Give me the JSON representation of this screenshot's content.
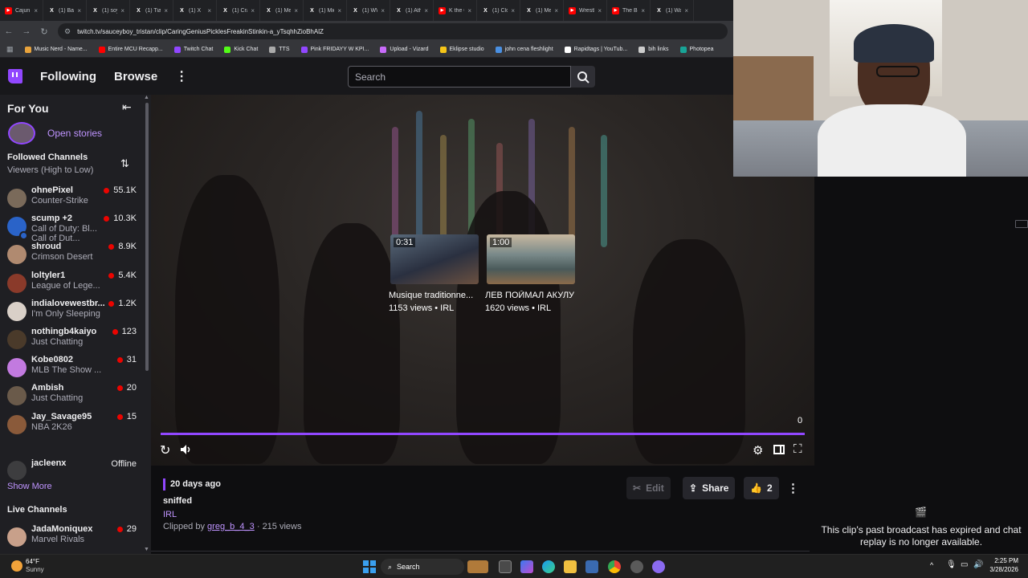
{
  "browser": {
    "tabs": [
      {
        "label": "Cajun C",
        "color": "#ff0000",
        "glyph": "▶"
      },
      {
        "label": "(1) Bad",
        "color": "#ffffff",
        "glyph": "X"
      },
      {
        "label": "(1) soy",
        "color": "#ffffff",
        "glyph": "X"
      },
      {
        "label": "(1) Tian",
        "color": "#ffffff",
        "glyph": "X"
      },
      {
        "label": "(1) X",
        "color": "#ffffff",
        "glyph": "X"
      },
      {
        "label": "(1) Craz",
        "color": "#ffffff",
        "glyph": "X"
      },
      {
        "label": "(1) Med",
        "color": "#ffffff",
        "glyph": "X"
      },
      {
        "label": "(1) Mich",
        "color": "#ffffff",
        "glyph": "X"
      },
      {
        "label": "(1) WW",
        "color": "#ffffff",
        "glyph": "X"
      },
      {
        "label": "(1) Athl",
        "color": "#ffffff",
        "glyph": "X"
      },
      {
        "label": "K the C",
        "color": "#ff0000",
        "glyph": "▶"
      },
      {
        "label": "(1) Clov",
        "color": "#ffffff",
        "glyph": "X"
      },
      {
        "label": "(1) Med",
        "color": "#ffffff",
        "glyph": "X"
      },
      {
        "label": "Wrestlin",
        "color": "#ff0000",
        "glyph": "▶"
      },
      {
        "label": "The BE",
        "color": "#ff0000",
        "glyph": "▶"
      },
      {
        "label": "(1) Wan",
        "color": "#ffffff",
        "glyph": "X"
      }
    ],
    "url": "twitch.tv/sauceyboy_tristan/clip/CaringGeniusPicklesFreakinStinkin-a_yTsqhhZioBhAlZ",
    "bookmarks": [
      {
        "label": "Music Nerd - Name...",
        "color": "#e8a33c"
      },
      {
        "label": "Entire MCU Recapp...",
        "color": "#ff0000"
      },
      {
        "label": "Twitch Chat",
        "color": "#9147ff"
      },
      {
        "label": "Kick Chat",
        "color": "#53fc18"
      },
      {
        "label": "TTS",
        "color": "#aaaaaa"
      },
      {
        "label": "Pink FRIDAYY W KPI...",
        "color": "#9147ff"
      },
      {
        "label": "Upload - Vizard",
        "color": "#c86bfa"
      },
      {
        "label": "Eklipse studio",
        "color": "#f5c518"
      },
      {
        "label": "john cena fleshlight",
        "color": "#4a90e2"
      },
      {
        "label": "Rapidtags | YouTub...",
        "color": "#ffffff"
      },
      {
        "label": "bih links",
        "color": "#cccccc"
      },
      {
        "label": "Photopea",
        "color": "#18a497"
      }
    ]
  },
  "topnav": {
    "following": "Following",
    "browse": "Browse",
    "search_placeholder": "Search"
  },
  "sidebar": {
    "for_you": "For You",
    "open_stories": "Open stories",
    "followed_title": "Followed Channels",
    "sort": "Viewers (High to Low)",
    "channels": [
      {
        "name": "ohnePixel",
        "game": "Counter-Strike",
        "viewers": "55.1K",
        "color": "#7a6a5a"
      },
      {
        "name": "scump +2",
        "game": "Call of Duty: Bl...",
        "game2": "Call of Dut...",
        "viewers": "10.3K",
        "color": "#2a63c8"
      },
      {
        "name": "shroud",
        "game": "Crimson Desert",
        "viewers": "8.9K",
        "color": "#b08a70"
      },
      {
        "name": "loltyler1",
        "game": "League of Lege...",
        "viewers": "5.4K",
        "color": "#8a3a2a"
      },
      {
        "name": "indialovewestbr...",
        "game": "I'm Only Sleeping",
        "viewers": "1.2K",
        "color": "#d9d0c8"
      },
      {
        "name": "nothingb4kaiyo",
        "game": "Just Chatting",
        "viewers": "123",
        "color": "#4a3a2a"
      },
      {
        "name": "Kobe0802",
        "game": "MLB The Show ...",
        "viewers": "31",
        "color": "#c27adf"
      },
      {
        "name": "Ambish",
        "game": "Just Chatting",
        "viewers": "20",
        "color": "#6a5a4a"
      },
      {
        "name": "Jay_Savage95",
        "game": "NBA 2K26",
        "viewers": "15",
        "color": "#8a5a3a"
      }
    ],
    "offline_channel": {
      "name": "jacleenx",
      "status": "Offline"
    },
    "show_more": "Show More",
    "live_title": "Live Channels",
    "live_channels": [
      {
        "name": "JadaMoniquex",
        "game": "Marvel Rivals",
        "viewers": "29",
        "color": "#c8a08a"
      }
    ]
  },
  "player": {
    "recommended": [
      {
        "duration": "0:31",
        "title": "Musique traditionne...",
        "meta": "1153 views • IRL"
      },
      {
        "duration": "1:00",
        "title": "ЛЕВ ПОЙМАЛ АКУЛУ",
        "meta": "1620 views • IRL"
      }
    ],
    "counter": "0",
    "progress": 1.0
  },
  "clip": {
    "age": "20 days ago",
    "title": "sniffed",
    "category": "IRL",
    "clipped_by_prefix": "Clipped by",
    "clipper": "greg_b_4_3",
    "views": "· 215 views",
    "edit": "Edit",
    "share": "Share",
    "likes": "2"
  },
  "chat_panel": {
    "message": "This clip's past broadcast has expired and chat replay is no longer available."
  },
  "taskbar": {
    "weather_temp": "64°F",
    "weather_desc": "Sunny",
    "search": "Search",
    "time": "2:25 PM",
    "date": "3/28/2026"
  },
  "colors": {
    "twitch_purple": "#9147ff",
    "live_red": "#eb0400"
  }
}
